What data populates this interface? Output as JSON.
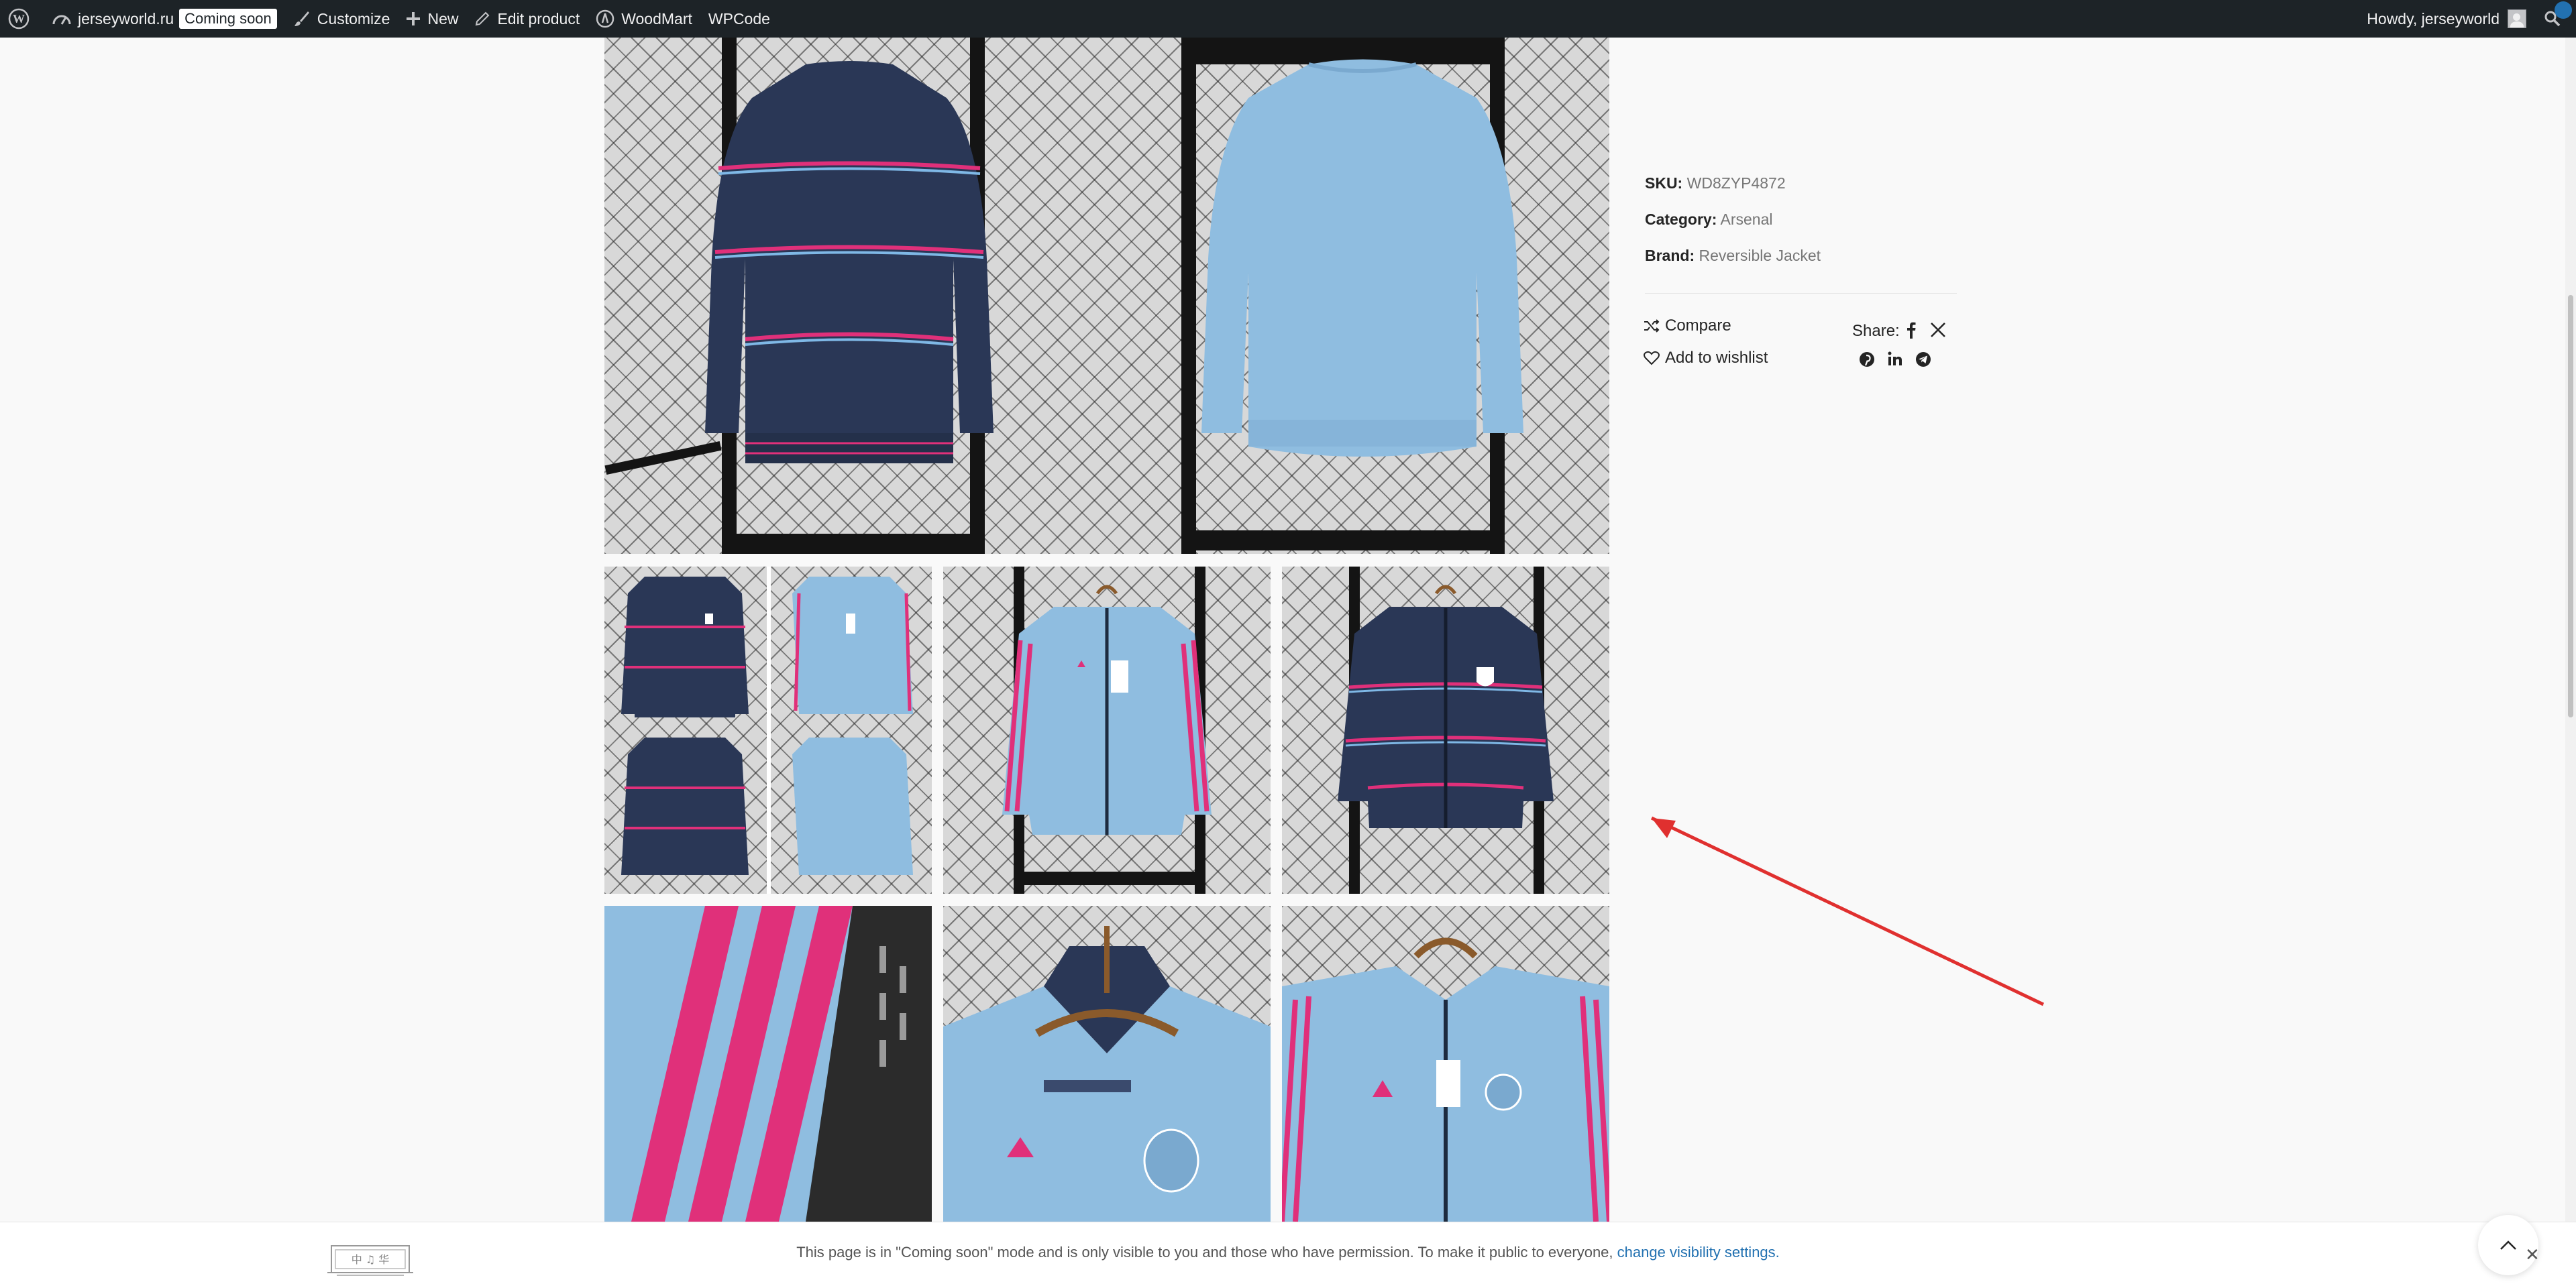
{
  "admin_bar": {
    "site_name": "jerseyworld.ru",
    "coming_soon_badge": "Coming soon",
    "customize": "Customize",
    "new": "New",
    "edit_product": "Edit product",
    "woodmart": "WoodMart",
    "wpcode": "WPCode",
    "howdy": "Howdy, jerseyworld"
  },
  "product_meta": {
    "sku_label": "SKU:",
    "sku_value": "WD8ZYP4872",
    "category_label": "Category:",
    "category_value": "Arsenal",
    "brand_label": "Brand:",
    "brand_value": "Reversible Jacket"
  },
  "actions": {
    "compare": "Compare",
    "wishlist": "Add to wishlist",
    "share_label": "Share:"
  },
  "notice": {
    "text": "This page is in \"Coming soon\" mode and is only visible to you and those who have permission. To make it public to everyone, ",
    "link": "change visibility settings."
  },
  "logo_text": "中 ♫ 华",
  "colors": {
    "admin_bar": "#1d2327",
    "navy": "#2a3756",
    "sky_blue": "#8fbde0",
    "pink": "#e0307a",
    "arrow": "#e0302f",
    "link": "#2271b1"
  }
}
